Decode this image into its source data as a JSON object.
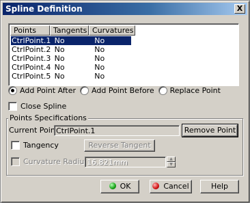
{
  "window": {
    "title": "Spline Definition",
    "close_icon": "close-icon",
    "close_glyph": "X"
  },
  "list": {
    "columns": [
      "Points",
      "Tangents",
      "Curvatures"
    ],
    "rows": [
      {
        "point": "CtrlPoint.1",
        "tangent": "No",
        "curvature": "No",
        "selected": true
      },
      {
        "point": "CtrlPoint.2",
        "tangent": "No",
        "curvature": "No"
      },
      {
        "point": "CtrlPoint.3",
        "tangent": "No",
        "curvature": "No"
      },
      {
        "point": "CtrlPoint.4",
        "tangent": "No",
        "curvature": "No"
      },
      {
        "point": "CtrlPoint.5",
        "tangent": "No",
        "curvature": "No"
      }
    ]
  },
  "add_mode": {
    "options": [
      "Add Point After",
      "Add Point Before",
      "Replace Point"
    ],
    "selected": "Add Point After"
  },
  "close_spline": {
    "label": "Close Spline",
    "checked": false
  },
  "point_specs": {
    "title": "Points Specifications",
    "current_point_label": "Current Point:",
    "current_point_value": "CtrlPoint.1",
    "remove_point_label": "Remove Point",
    "tangency_label": "Tangency",
    "reverse_tangent_label": "Reverse Tangent",
    "curvature_radius_label": "Curvature Radius:",
    "curvature_radius_value": "16.821mm"
  },
  "footer": {
    "ok_label": "OK",
    "cancel_label": "Cancel",
    "help_label": "Help"
  },
  "colors": {
    "title_bar": "#0a246a",
    "selection": "#0a246a",
    "face": "#d4d0c8"
  }
}
